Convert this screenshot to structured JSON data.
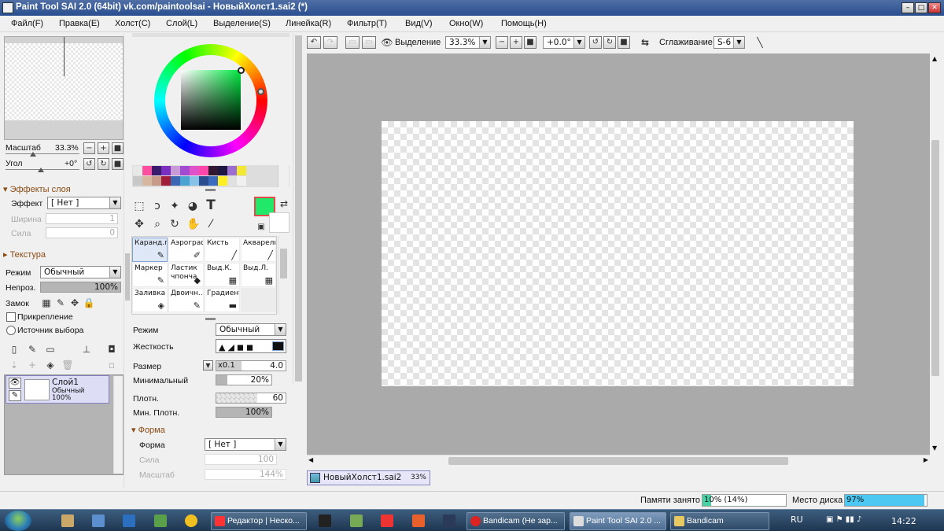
{
  "window": {
    "title": "Paint Tool SAI 2.0 (64bit) vk.com/paintoolsai - НовыйХолст1.sai2 (*)",
    "minimize": "–",
    "maximize": "□",
    "close": "✕"
  },
  "menu": [
    "Файл(F)",
    "Правка(E)",
    "Холст(C)",
    "Слой(L)",
    "Выделение(S)",
    "Линейка(R)",
    "Фильтр(T)",
    "Вид(V)",
    "Окно(W)",
    "Помощь(H)"
  ],
  "navigator": {
    "zoom_label": "Масштаб",
    "zoom_value": "33.3%",
    "angle_label": "Угол",
    "angle_value": "+0°"
  },
  "layer_effects": {
    "header": "Эффекты слоя",
    "effect_label": "Эффект",
    "effect_value": "[ Нет ]",
    "width_label": "Ширина",
    "width_value": "1",
    "strength_label": "Сила",
    "strength_value": "0"
  },
  "texture": {
    "header": "Текстура",
    "mode_label": "Режим",
    "mode_value": "Обычный",
    "opacity_label": "Непроз.",
    "opacity_value": "100%",
    "opacity_level": 1.0,
    "lock_label": "Замок",
    "clip_label": "Прикрепление",
    "source_label": "Источник выбора"
  },
  "layers": [
    {
      "name": "Слой1",
      "mode": "Обычный",
      "opacity": "100%"
    }
  ],
  "color": {
    "current": "#22e86a",
    "secondary": "#ffffff",
    "palette": [
      "#e8e8e8",
      "#ff4da0",
      "#3a1c6e",
      "#7b2fbf",
      "#c89bd8",
      "#a24ad1",
      "#e052c9",
      "#ff44aa",
      "#311830",
      "#1c1640",
      "#9b6fcf",
      "#f5e832",
      "#c8c8c8",
      "#d6b7a0",
      "#c79a8a",
      "#a21d3a",
      "#3a66b3",
      "#4aa3d1",
      "#86c1e8",
      "#2a4d8f",
      "#3b6bbf",
      "#ffee22",
      "#e0e0e0",
      "#f0f0f0"
    ]
  },
  "tools": [
    {
      "label": "Каранд.п",
      "icon": "pencil-icon",
      "glyph": "✎",
      "selected": true
    },
    {
      "label": "Аэрограф",
      "icon": "airbrush-icon",
      "glyph": "✐",
      "selected": false
    },
    {
      "label": "Кисть",
      "icon": "brush-icon",
      "glyph": "╱",
      "selected": false
    },
    {
      "label": "Акварель",
      "icon": "watercolor-icon",
      "glyph": "╱",
      "selected": false
    },
    {
      "label": "Маркер",
      "icon": "marker-icon",
      "glyph": "✎",
      "selected": false
    },
    {
      "label": "Ластик чпонча",
      "icon": "eraser-icon",
      "glyph": "◆",
      "selected": false
    },
    {
      "label": "Выд.К.",
      "icon": "select-pen-icon",
      "glyph": "▦",
      "selected": false
    },
    {
      "label": "Выд.Л.",
      "icon": "select-eraser-icon",
      "glyph": "▦",
      "selected": false
    },
    {
      "label": "Заливка",
      "icon": "bucket-icon",
      "glyph": "◈",
      "selected": false
    },
    {
      "label": "Двоичн...",
      "icon": "binary-pen-icon",
      "glyph": "✎",
      "selected": false
    },
    {
      "label": "Градиент",
      "icon": "gradient-icon",
      "glyph": "▬",
      "selected": false
    }
  ],
  "brush": {
    "mode_label": "Режим",
    "mode_value": "Обычный",
    "hardness_label": "Жесткость",
    "size_label": "Размер",
    "size_mult": "x0.1",
    "size_value": "4.0",
    "min_label": "Минимальный",
    "min_value": "20%",
    "min_level": 0.2,
    "density_label": "Плотн.",
    "density_value": "60",
    "min_density_label": "Мин. Плотн.",
    "min_density_value": "100%",
    "min_density_level": 1.0,
    "shape_header": "Форма",
    "shape_label": "Форма",
    "shape_value": "[ Нет ]",
    "shape_strength_label": "Сила",
    "shape_strength_value": "100",
    "shape_scale_label": "Масштаб",
    "shape_scale_value": "144%"
  },
  "toolbar": {
    "selection_label": "Выделение",
    "zoom_value": "33.3%",
    "angle_value": "+0.0°",
    "smoothing_label": "Сглаживание",
    "smoothing_value": "S-6"
  },
  "document_tab": {
    "name": "НовыйХолст1.sai2",
    "zoom": "33%"
  },
  "status": {
    "memory_label": "Памяти занято",
    "memory_value": "10% (14%)",
    "memory_level": 0.1,
    "disk_label": "Место диска",
    "disk_value": "97%",
    "disk_level": 0.97
  },
  "taskbar": {
    "buttons": [
      {
        "label": "Редактор | Неско...",
        "active": false
      },
      {
        "label": "Bandicam (Не зар...",
        "active": false
      },
      {
        "label": "Paint Tool SAI 2.0 ...",
        "active": true
      },
      {
        "label": "Bandicam",
        "active": false
      }
    ],
    "lang": "RU",
    "time": "14:22"
  }
}
